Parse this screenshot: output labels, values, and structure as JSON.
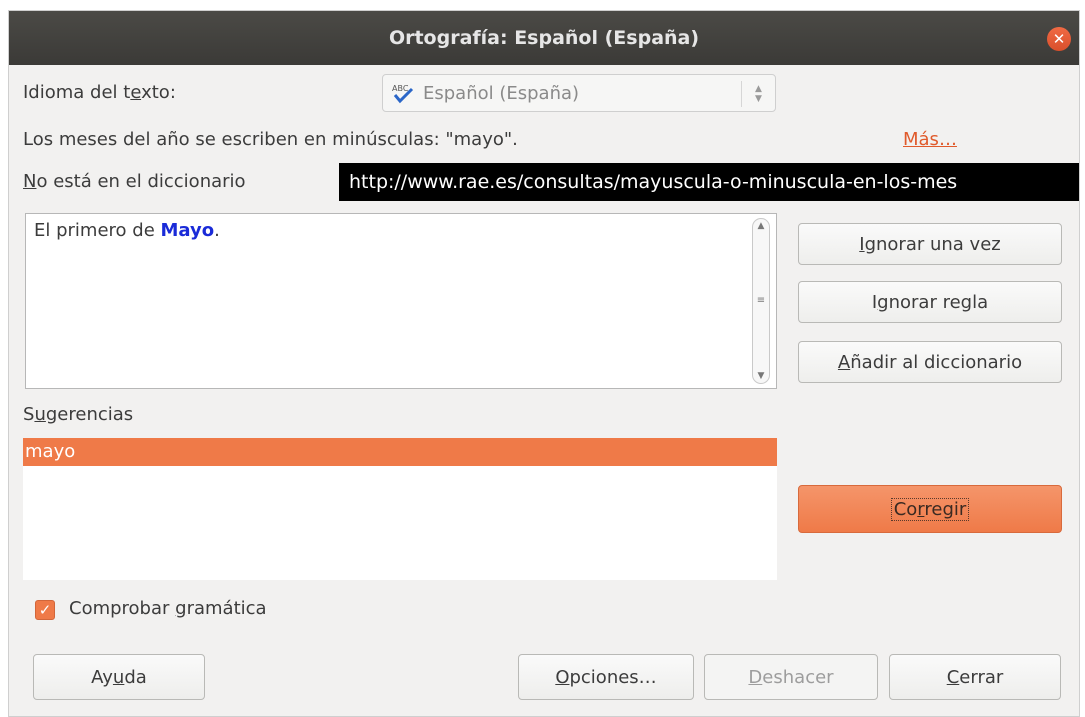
{
  "window": {
    "title": "Ortografía: Español (España)",
    "close_symbol": "✕"
  },
  "language": {
    "label_pre": "Idioma del t",
    "label_mnemonic": "e",
    "label_post": "xto:",
    "value": "Español (España)",
    "icon": "abc-spellcheck-icon"
  },
  "message": {
    "text": "Los meses del año se escriben en minúsculas: \"mayo\".",
    "more_link": "Más…"
  },
  "not_in_dictionary": {
    "mnemonic": "N",
    "rest": "o está en el diccionario"
  },
  "tooltip": {
    "url": "http://www.rae.es/consultas/mayuscula-o-minuscula-en-los-mes"
  },
  "sentence": {
    "before": "El primero de ",
    "error_word": "Mayo",
    "after": "."
  },
  "right_buttons": {
    "ignore_once_mn": "I",
    "ignore_once_rest": "gnorar una vez",
    "ignore_rule_pre": "I",
    "ignore_rule_mn": "g",
    "ignore_rule_post": "norar regla",
    "add_dict_mn": "A",
    "add_dict_rest": "ñadir al diccionario",
    "correct_pre": "Co",
    "correct_mn": "r",
    "correct_post": "regir"
  },
  "suggestions": {
    "label_pre": "S",
    "label_mn": "u",
    "label_post": "gerencias",
    "items": [
      "mayo"
    ]
  },
  "grammar_check": {
    "label_pre": "Comprobar ",
    "label_mn": "g",
    "label_post": "ramática",
    "checked": true,
    "check_symbol": "✓"
  },
  "footer": {
    "help_pre": "Ay",
    "help_mn": "u",
    "help_post": "da",
    "options_mn": "O",
    "options_rest": "pciones…",
    "undo_mn": "D",
    "undo_rest": "eshacer",
    "close_mn": "C",
    "close_rest": "errar"
  },
  "colors": {
    "accent": "#ef7a48",
    "error_word": "#1a2bd8",
    "titlebar": "#3b3a37",
    "link": "#e05a2b"
  }
}
